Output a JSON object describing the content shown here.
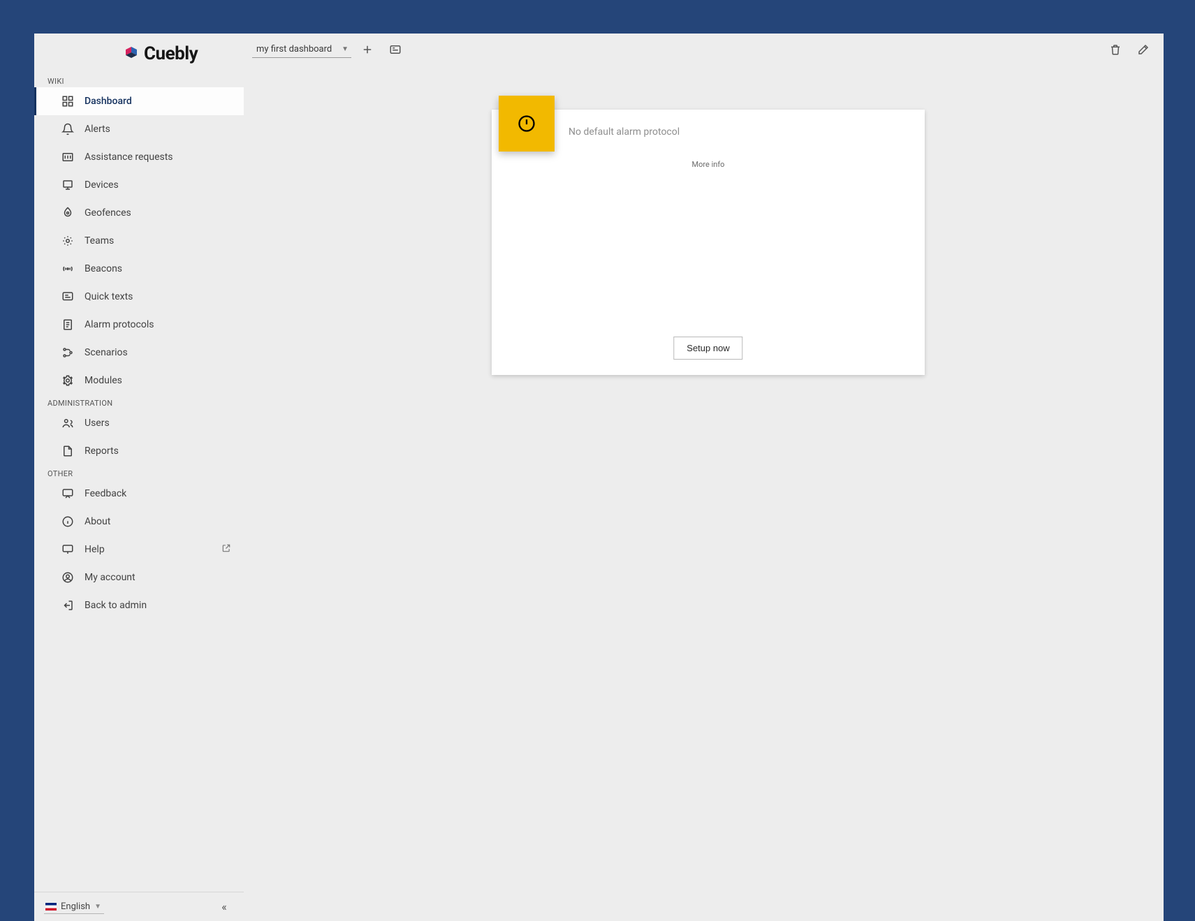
{
  "brand": {
    "name": "Cuebly"
  },
  "topbar": {
    "dashboard_selected": "my first dashboard"
  },
  "sidebar": {
    "sections": [
      {
        "label": "WIKI",
        "items": [
          {
            "label": "Dashboard",
            "icon": "dashboard-icon",
            "active": true
          },
          {
            "label": "Alerts",
            "icon": "bell-icon"
          },
          {
            "label": "Assistance requests",
            "icon": "assistance-icon"
          },
          {
            "label": "Devices",
            "icon": "devices-icon"
          },
          {
            "label": "Geofences",
            "icon": "geofence-icon"
          },
          {
            "label": "Teams",
            "icon": "teams-icon"
          },
          {
            "label": "Beacons",
            "icon": "beacon-icon"
          },
          {
            "label": "Quick texts",
            "icon": "quicktext-icon"
          },
          {
            "label": "Alarm protocols",
            "icon": "protocol-icon"
          },
          {
            "label": "Scenarios",
            "icon": "scenario-icon"
          },
          {
            "label": "Modules",
            "icon": "modules-icon"
          }
        ]
      },
      {
        "label": "ADMINISTRATION",
        "items": [
          {
            "label": "Users",
            "icon": "users-icon"
          },
          {
            "label": "Reports",
            "icon": "reports-icon"
          }
        ]
      },
      {
        "label": "OTHER",
        "items": [
          {
            "label": "Feedback",
            "icon": "feedback-icon"
          },
          {
            "label": "About",
            "icon": "about-icon"
          },
          {
            "label": "Help",
            "icon": "help-icon",
            "external": true
          },
          {
            "label": "My account",
            "icon": "account-icon"
          },
          {
            "label": "Back to admin",
            "icon": "back-icon"
          }
        ]
      }
    ]
  },
  "footer": {
    "language": "English"
  },
  "widget": {
    "title": "No default alarm protocol",
    "more_info": "More info",
    "setup_button": "Setup now"
  }
}
